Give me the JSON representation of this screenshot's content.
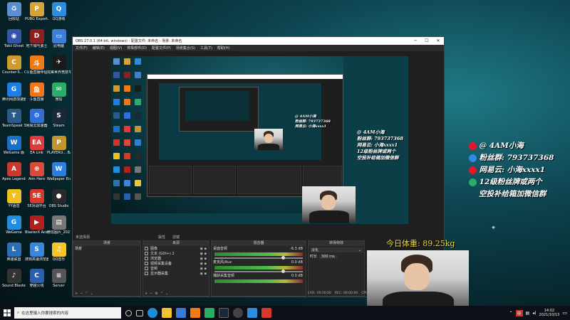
{
  "desktop": {
    "icons": [
      {
        "label": "回收站",
        "color": "#5a8fd1",
        "glyph": "♻"
      },
      {
        "label": "PUBG Export...",
        "color": "#d4a43a",
        "glyph": "P"
      },
      {
        "label": "QQ游戏",
        "color": "#2d8ce0",
        "glyph": "Q"
      },
      {
        "label": "Tobii Ghost",
        "color": "#3354a8",
        "glyph": "◉"
      },
      {
        "label": "地下城与勇士",
        "color": "#8a2020",
        "glyph": "D"
      },
      {
        "label": "此电脑",
        "color": "#3c7ed8",
        "glyph": "▭"
      },
      {
        "label": "Counter-S... Global Off...",
        "color": "#d19a2e",
        "glyph": "C"
      },
      {
        "label": "斗鱼直播伴侣",
        "color": "#f07a14",
        "glyph": "斗"
      },
      {
        "label": "完美世界竞技平台 Online...",
        "color": "#1a1a1a",
        "glyph": "✈"
      },
      {
        "label": "腾讯网游加速器 WeGame...",
        "color": "#1d7fe6",
        "glyph": "G"
      },
      {
        "label": "斗鱼直播",
        "color": "#f3751b",
        "glyph": "鱼"
      },
      {
        "label": "微信",
        "color": "#2aae67",
        "glyph": "✉"
      },
      {
        "label": "TeamSpeak 3",
        "color": "#2b5a8a",
        "glyph": "T"
      },
      {
        "label": "网易云加速器",
        "color": "#2f6fd6",
        "glyph": "⚙"
      },
      {
        "label": "Steam",
        "color": "#1b2838",
        "glyph": "S"
      },
      {
        "label": "WeGame 版",
        "color": "#1a6fc9",
        "glyph": "W"
      },
      {
        "label": "EA Link",
        "color": "#e13a3a",
        "glyph": "EA"
      },
      {
        "label": "PLAYERU... BATTLEGR...",
        "color": "#c4952e",
        "glyph": "P"
      },
      {
        "label": "Apex Legends",
        "color": "#c83a2e",
        "glyph": "A"
      },
      {
        "label": "Aim Hero",
        "color": "#d84a3a",
        "glyph": "⊕"
      },
      {
        "label": "Wallpaper Engine",
        "color": "#2e7de0",
        "glyph": "W"
      },
      {
        "label": "YY语音",
        "color": "#f0c020",
        "glyph": "Y"
      },
      {
        "label": "5E对战平台",
        "color": "#d43a2a",
        "glyph": "5E"
      },
      {
        "label": "OBS Studio",
        "color": "#2a2a2a",
        "glyph": "●"
      },
      {
        "label": "WeGame",
        "color": "#1f8de0",
        "glyph": "G"
      },
      {
        "label": "BlasterX Acoustic...",
        "color": "#b0201f",
        "glyph": "▶"
      },
      {
        "label": "微信图片_2021031...",
        "color": "#777777",
        "glyph": "▤"
      },
      {
        "label": "英雄联盟",
        "color": "#2c6fb5",
        "glyph": "L"
      },
      {
        "label": "搜狗高速浏览器",
        "color": "#3a86d9",
        "glyph": "S"
      },
      {
        "label": "QQ音乐",
        "color": "#f4c528",
        "glyph": "♫"
      },
      {
        "label": "Sound Blaster...",
        "color": "#333333",
        "glyph": "♪"
      },
      {
        "label": "穿越火线",
        "color": "#2a5fb0",
        "glyph": "C"
      },
      {
        "label": "Server",
        "color": "#555555",
        "glyph": "≡"
      }
    ]
  },
  "obs": {
    "title": "OBS 27.0.1 (64-bit, windows) - 配置文件: 未命名 - 场景: 未命名",
    "menu": [
      "文件(F)",
      "编辑(E)",
      "视图(V)",
      "停靠部件(D)",
      "配置文件(P)",
      "场景集合(S)",
      "工具(T)",
      "帮助(H)"
    ],
    "status_bar_left": "未选择源",
    "props_button": "属性",
    "filters_button": "滤镜",
    "panels": {
      "scenes": {
        "title": "场景",
        "items": [
          "场景"
        ]
      },
      "sources": {
        "title": "来源",
        "items": [
          "图像",
          "文本 (GDI+) 2",
          "浏览器",
          "视频采集设备",
          "音频",
          "显示器采集"
        ]
      },
      "mixer": {
        "title": "混音器",
        "channels": [
          {
            "name": "桌面音频",
            "db": "-6.3 dB"
          },
          {
            "name": "麦克风/Aux",
            "db": "0.0 dB"
          },
          {
            "name": "捕获采集音频",
            "db": "0.0 dB"
          }
        ]
      },
      "transitions": {
        "title": "转场特效",
        "type": "淡化",
        "duration_label": "时长",
        "duration": "300 ms"
      }
    },
    "status": {
      "live": "LIVE: 00:00:00",
      "rec": "REC: 00:00:00",
      "cpu": "CPU: 4.1%, 60.00 fps"
    }
  },
  "watermark": {
    "line1": "@ 4AM小海",
    "line2": "粉丝群: 793737368",
    "line3": "网易云: 小海xxxx1",
    "line4": "12级粉丝牌或两个",
    "line5": "空投补给箱加微信群"
  },
  "weight_text": "今日体重: 89.25kg",
  "taskbar": {
    "search_placeholder": "在这里输入你要搜索的内容",
    "time": "14:02",
    "date": "2021/10/13",
    "lang": "中"
  },
  "colors": {
    "accent": "#1f7a86",
    "weibo": "#e6162d",
    "weight": "#e8d84a"
  }
}
